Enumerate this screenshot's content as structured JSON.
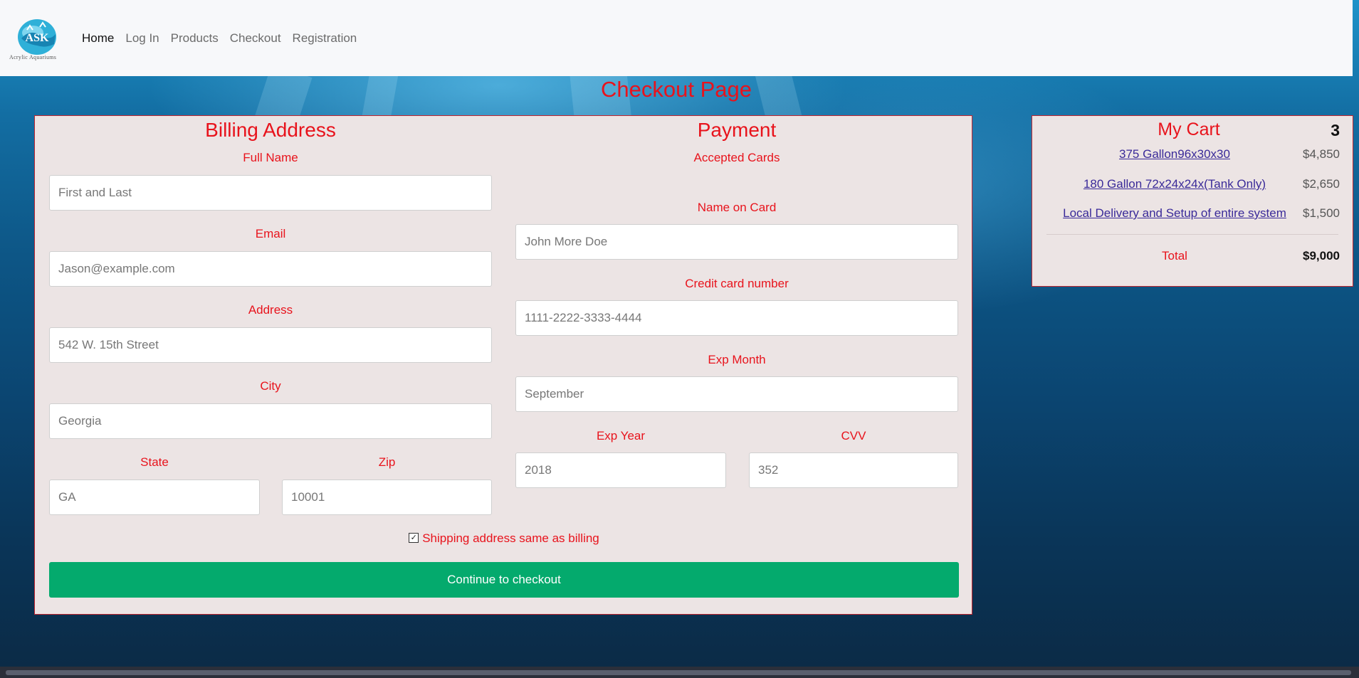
{
  "brand": {
    "logo_text": "Acrylic Aquariums"
  },
  "nav": {
    "items": [
      "Home",
      "Log In",
      "Products",
      "Checkout",
      "Registration"
    ],
    "active": "Home"
  },
  "page": {
    "title": "Checkout Page"
  },
  "billing": {
    "title": "Billing Address",
    "full_name_label": "Full Name",
    "full_name_placeholder": "First and Last",
    "email_label": "Email",
    "email_placeholder": "Jason@example.com",
    "address_label": "Address",
    "address_placeholder": "542 W. 15th Street",
    "city_label": "City",
    "city_placeholder": "Georgia",
    "state_label": "State",
    "state_placeholder": "GA",
    "zip_label": "Zip",
    "zip_placeholder": "10001"
  },
  "payment": {
    "title": "Payment",
    "accepted_cards_label": "Accepted Cards",
    "name_on_card_label": "Name on Card",
    "name_on_card_placeholder": "John More Doe",
    "card_number_label": "Credit card number",
    "card_number_placeholder": "1111-2222-3333-4444",
    "exp_month_label": "Exp Month",
    "exp_month_placeholder": "September",
    "exp_year_label": "Exp Year",
    "exp_year_placeholder": "2018",
    "cvv_label": "CVV",
    "cvv_placeholder": "352"
  },
  "form": {
    "same_address_label": "Shipping address same as billing",
    "same_address_checked": true,
    "submit_label": "Continue to checkout"
  },
  "cart": {
    "title": "My Cart",
    "count": "3",
    "items": [
      {
        "name": "375 Gallon96x30x30",
        "price": "$4,850"
      },
      {
        "name": "180 Gallon 72x24x24x(Tank Only)",
        "price": "$2,650"
      },
      {
        "name": "Local Delivery and Setup of entire system",
        "price": "$1,500"
      }
    ],
    "total_label": "Total",
    "total_value": "$9,000"
  },
  "colors": {
    "accent_red": "#e8131c",
    "button_green": "#04aa6d",
    "card_bg": "#ece4e4",
    "link_purple": "#3a2a99"
  }
}
